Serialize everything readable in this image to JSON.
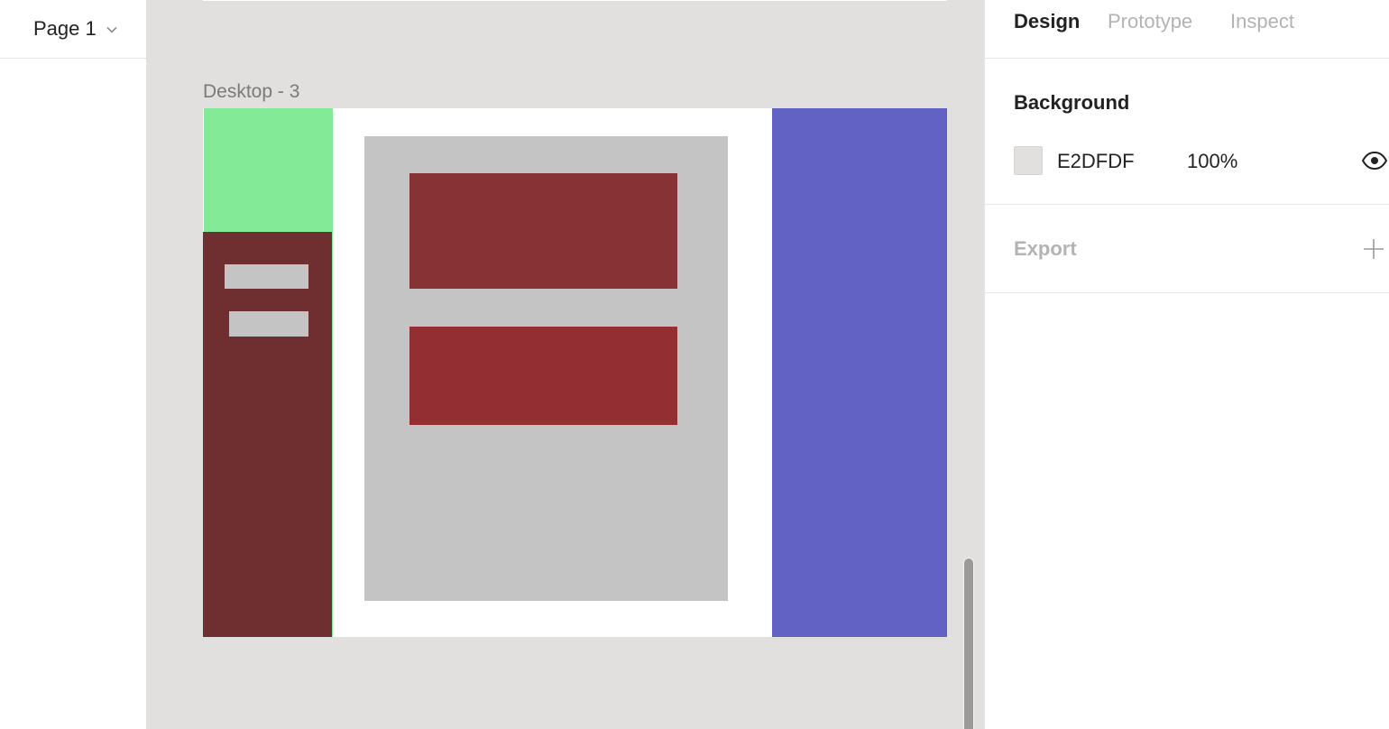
{
  "page_selector": {
    "label": "Page 1",
    "icon": "chevron-down-icon"
  },
  "canvas": {
    "background": "#E2DFDF",
    "frame_title": "Desktop - 3",
    "colors": {
      "green": "#83EB97",
      "sidebar": "#6F2E2F",
      "card": "#C4C4C4",
      "red_1": "#873335",
      "red_2": "#932F33",
      "purple": "#6262C5"
    }
  },
  "right_panel": {
    "tabs": [
      {
        "label": "Design",
        "active": true
      },
      {
        "label": "Prototype",
        "active": false
      },
      {
        "label": "Inspect",
        "active": false
      }
    ],
    "background": {
      "title": "Background",
      "hex": "E2DFDF",
      "opacity": "100%",
      "visibility_icon": "eye-icon"
    },
    "export": {
      "title": "Export",
      "add_icon": "plus-icon"
    }
  }
}
